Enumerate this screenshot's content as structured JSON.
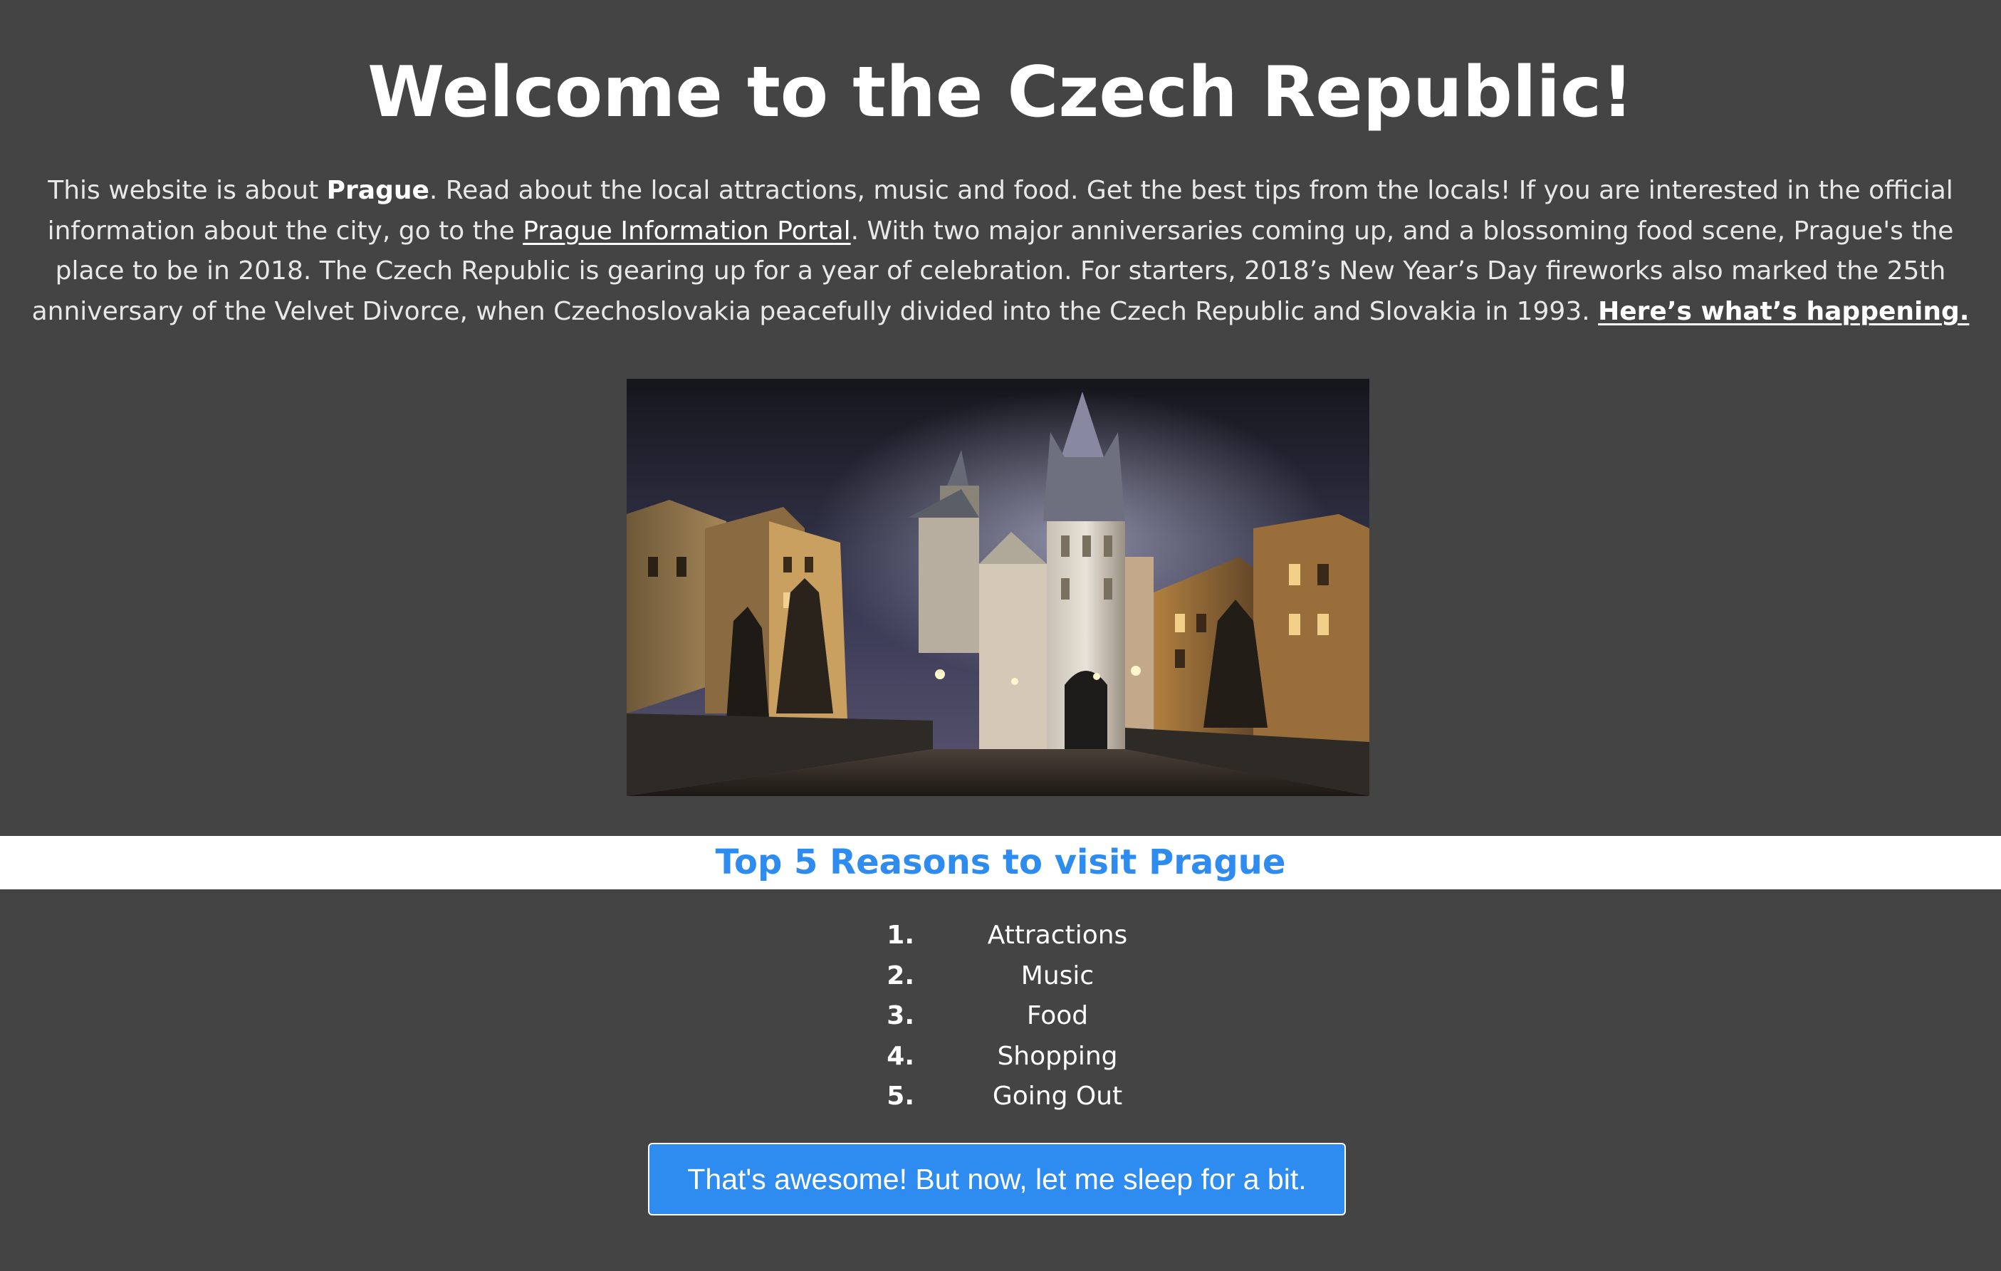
{
  "page": {
    "title": "Welcome to the Czech Republic!"
  },
  "intro": {
    "part1": "This website is about ",
    "city": "Prague",
    "part2": ". Read about the local attractions, music and food. Get the best tips from the locals! If you are interested in the official information about the city, go to the ",
    "portal_link": "Prague Information Portal",
    "part3": ". With two major anniversaries coming up, and a blossoming food scene, Prague's the place to be in 2018. The Czech Republic is gearing up for a year of celebration. For starters, 2018’s New Year’s Day fireworks also marked the 25th anniversary of the Velvet Divorce, when Czechoslovakia peacefully divided into the Czech Republic and Slovakia in 1993. ",
    "happening_link": "Here’s what’s happening."
  },
  "hero_image": {
    "alt": "Charles Bridge at night"
  },
  "reasons": {
    "title": "Top 5 Reasons to visit Prague",
    "items": [
      {
        "num": "1.",
        "label": "Attractions"
      },
      {
        "num": "2.",
        "label": "Music"
      },
      {
        "num": "3.",
        "label": "Food"
      },
      {
        "num": "4.",
        "label": "Shopping"
      },
      {
        "num": "5.",
        "label": "Going Out"
      }
    ]
  },
  "button": {
    "label": "That's awesome! But now, let me sleep for a bit."
  },
  "colors": {
    "background": "#444444",
    "accent": "#2e8bf0",
    "text": "#ffffff"
  }
}
